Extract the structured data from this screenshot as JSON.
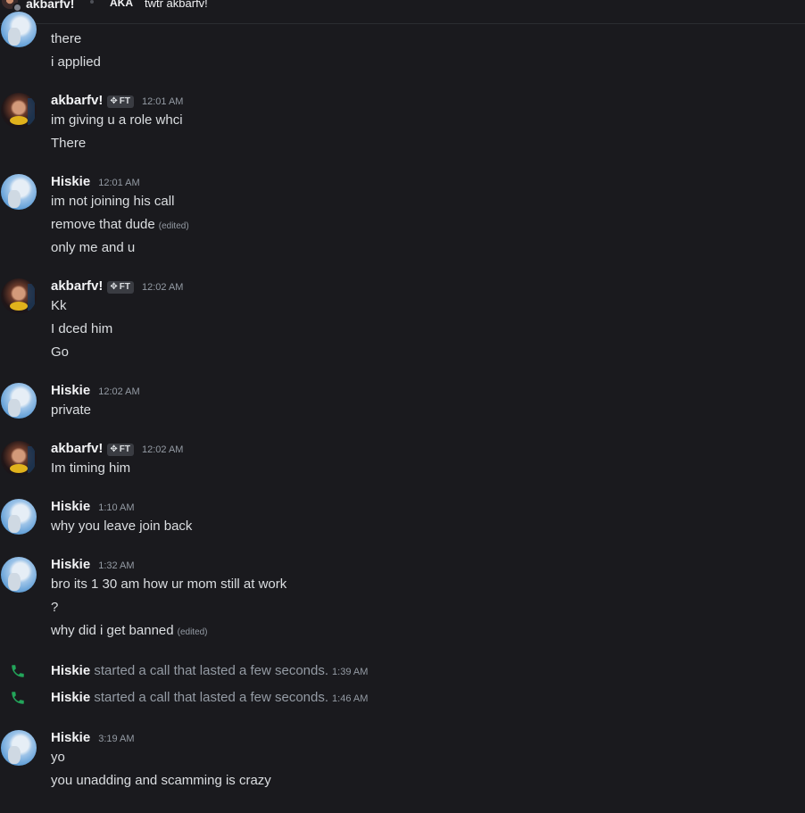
{
  "topbar": {
    "username": "akbarfv!",
    "tag": "AKA",
    "extra": "twtr akbarfv!"
  },
  "groups": [
    {
      "lines": [
        "there",
        "i applied"
      ]
    },
    {
      "author": "akbarfv!",
      "badge": "FT",
      "time": "12:01 AM",
      "lines": [
        "im giving u a role whci",
        "There"
      ]
    },
    {
      "author": "Hiskie",
      "time": "12:01 AM",
      "lines": [
        "im not joining his call",
        "remove that dude",
        "only me and u"
      ]
    },
    {
      "author": "akbarfv!",
      "badge": "FT",
      "time": "12:02 AM",
      "lines": [
        "Kk",
        "I dced him",
        "Go"
      ]
    },
    {
      "author": "Hiskie",
      "time": "12:02 AM",
      "lines": [
        "private"
      ]
    },
    {
      "author": "akbarfv!",
      "badge": "FT",
      "time": "12:02 AM",
      "lines": [
        "Im timing him"
      ]
    },
    {
      "author": "Hiskie",
      "time": "1:10 AM",
      "lines": [
        "why you leave join back"
      ]
    },
    {
      "author": "Hiskie",
      "time": "1:32 AM",
      "lines": [
        "bro its 1 30 am how ur mom still at work",
        "?",
        "why did i get banned"
      ]
    },
    {
      "author": "Hiskie",
      "time": "3:19 AM",
      "lines": [
        "yo",
        "you unadding and scamming is crazy"
      ]
    }
  ],
  "edited_label": "(edited)",
  "calls": [
    {
      "author": "Hiskie",
      "text": "started a call that lasted a few seconds.",
      "time": "1:39 AM"
    },
    {
      "author": "Hiskie",
      "text": "started a call that lasted a few seconds.",
      "time": "1:46 AM"
    }
  ],
  "colors": {
    "background": "#1a1a1e",
    "call_icon": "#23a55a",
    "muted": "#949ba4"
  },
  "icons": {
    "call": "phone-icon",
    "badge": "guild-tag-icon"
  }
}
